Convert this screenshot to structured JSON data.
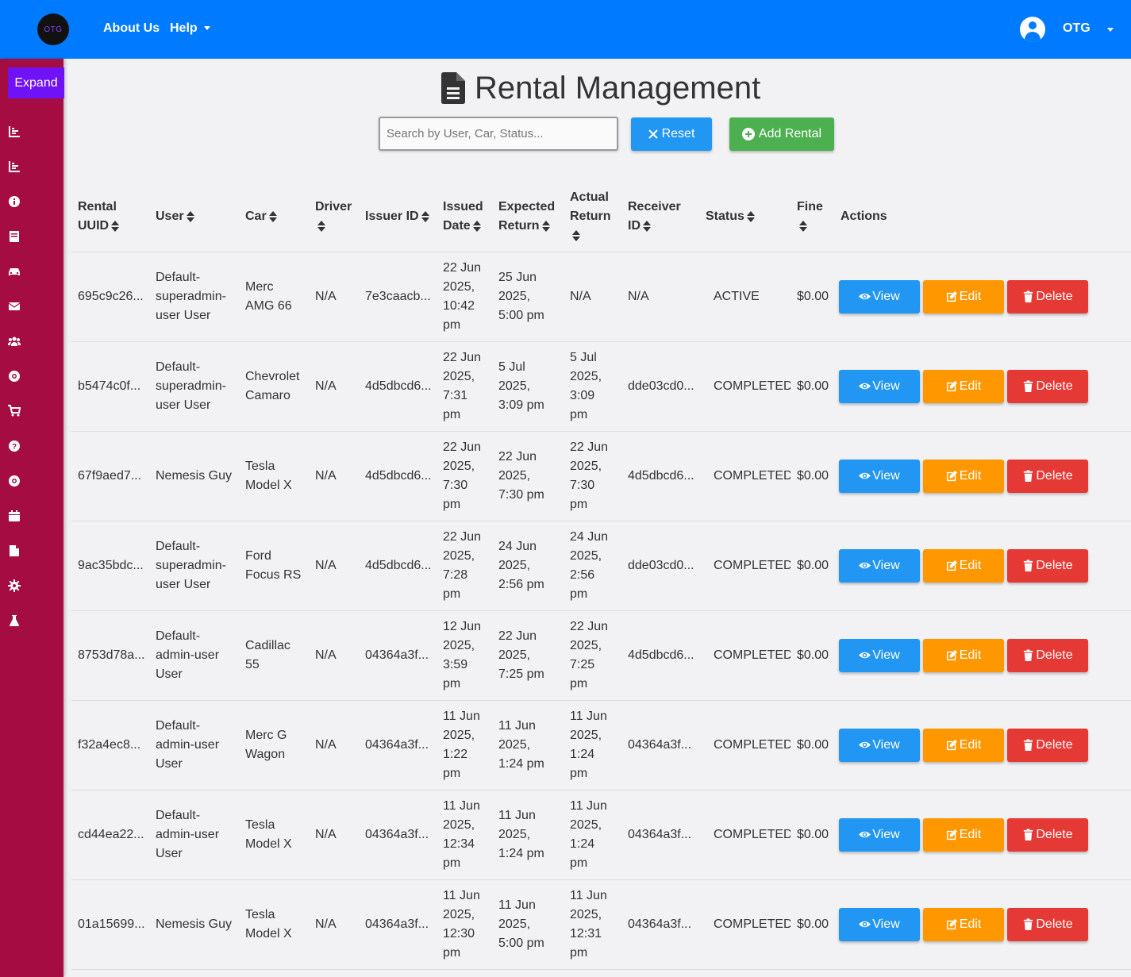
{
  "navbar": {
    "logo_text": "OTG",
    "about_label": "About Us",
    "help_label": "Help",
    "user_name": "OTG"
  },
  "sidebar": {
    "expand_label": "Expand",
    "icons": [
      "chart-icon",
      "chart-icon",
      "info-icon",
      "book-icon",
      "car-icon",
      "envelope-icon",
      "users-icon",
      "life-ring-icon",
      "cart-icon",
      "question-icon",
      "life-ring-icon",
      "calendar-icon",
      "file-icon",
      "gear-icon",
      "flask-icon"
    ]
  },
  "page": {
    "title": "Rental Management",
    "search_placeholder": "Search by User, Car, Status...",
    "reset_label": "Reset",
    "add_label": "Add Rental"
  },
  "table": {
    "headers": [
      {
        "label": "Rental UUID",
        "sortable": true
      },
      {
        "label": "User",
        "sortable": true
      },
      {
        "label": "Car",
        "sortable": true
      },
      {
        "label": "Driver",
        "sortable": true
      },
      {
        "label": "Issuer ID",
        "sortable": true
      },
      {
        "label": "Issued Date",
        "sortable": true
      },
      {
        "label": "Expected Return",
        "sortable": true
      },
      {
        "label": "Actual Return",
        "sortable": true
      },
      {
        "label": "Receiver ID",
        "sortable": true
      },
      {
        "label": "Status",
        "sortable": true
      },
      {
        "label": "Fine",
        "sortable": true
      },
      {
        "label": "Actions",
        "sortable": false
      }
    ],
    "action_labels": {
      "view": "View",
      "edit": "Edit",
      "delete": "Delete"
    },
    "rows": [
      {
        "uuid": "695c9c26...",
        "user": "Default-superadmin-user User",
        "car": "Merc AMG 66",
        "driver": "N/A",
        "issuer": "7e3caacb...",
        "issued": "22 Jun 2025, 10:42 pm",
        "expected": "25 Jun 2025, 5:00 pm",
        "actual": "N/A",
        "receiver": "N/A",
        "status": "ACTIVE",
        "fine": "$0.00"
      },
      {
        "uuid": "b5474c0f...",
        "user": "Default-superadmin-user User",
        "car": "Chevrolet Camaro",
        "driver": "N/A",
        "issuer": "4d5dbcd6...",
        "issued": "22 Jun 2025, 7:31 pm",
        "expected": "5 Jul 2025, 3:09 pm",
        "actual": "5 Jul 2025, 3:09 pm",
        "receiver": "dde03cd0...",
        "status": "COMPLETED",
        "fine": "$0.00"
      },
      {
        "uuid": "67f9aed7...",
        "user": "Nemesis Guy",
        "car": "Tesla Model X",
        "driver": "N/A",
        "issuer": "4d5dbcd6...",
        "issued": "22 Jun 2025, 7:30 pm",
        "expected": "22 Jun 2025, 7:30 pm",
        "actual": "22 Jun 2025, 7:30 pm",
        "receiver": "4d5dbcd6...",
        "status": "COMPLETED",
        "fine": "$0.00"
      },
      {
        "uuid": "9ac35bdc...",
        "user": "Default-superadmin-user User",
        "car": "Ford Focus RS",
        "driver": "N/A",
        "issuer": "4d5dbcd6...",
        "issued": "22 Jun 2025, 7:28 pm",
        "expected": "24 Jun 2025, 2:56 pm",
        "actual": "24 Jun 2025, 2:56 pm",
        "receiver": "dde03cd0...",
        "status": "COMPLETED",
        "fine": "$0.00"
      },
      {
        "uuid": "8753d78a...",
        "user": "Default-admin-user User",
        "car": "Cadillac 55",
        "driver": "N/A",
        "issuer": "04364a3f...",
        "issued": "12 Jun 2025, 3:59 pm",
        "expected": "22 Jun 2025, 7:25 pm",
        "actual": "22 Jun 2025, 7:25 pm",
        "receiver": "4d5dbcd6...",
        "status": "COMPLETED",
        "fine": "$0.00"
      },
      {
        "uuid": "f32a4ec8...",
        "user": "Default-admin-user User",
        "car": "Merc G Wagon",
        "driver": "N/A",
        "issuer": "04364a3f...",
        "issued": "11 Jun 2025, 1:22 pm",
        "expected": "11 Jun 2025, 1:24 pm",
        "actual": "11 Jun 2025, 1:24 pm",
        "receiver": "04364a3f...",
        "status": "COMPLETED",
        "fine": "$0.00"
      },
      {
        "uuid": "cd44ea22...",
        "user": "Default-admin-user User",
        "car": "Tesla Model X",
        "driver": "N/A",
        "issuer": "04364a3f...",
        "issued": "11 Jun 2025, 12:34 pm",
        "expected": "11 Jun 2025, 1:24 pm",
        "actual": "11 Jun 2025, 1:24 pm",
        "receiver": "04364a3f...",
        "status": "COMPLETED",
        "fine": "$0.00"
      },
      {
        "uuid": "01a15699...",
        "user": "Nemesis Guy",
        "car": "Tesla Model X",
        "driver": "N/A",
        "issuer": "04364a3f...",
        "issued": "11 Jun 2025, 12:30 pm",
        "expected": "11 Jun 2025, 5:00 pm",
        "actual": "11 Jun 2025, 12:31 pm",
        "receiver": "04364a3f...",
        "status": "COMPLETED",
        "fine": "$0.00"
      }
    ]
  },
  "colors": {
    "navbar": "#007bff",
    "sidebar": "#a50d42",
    "expand": "#6f12f5",
    "view": "#2196f3",
    "edit": "#ff9800",
    "delete": "#e53935",
    "add": "#4caf50"
  }
}
